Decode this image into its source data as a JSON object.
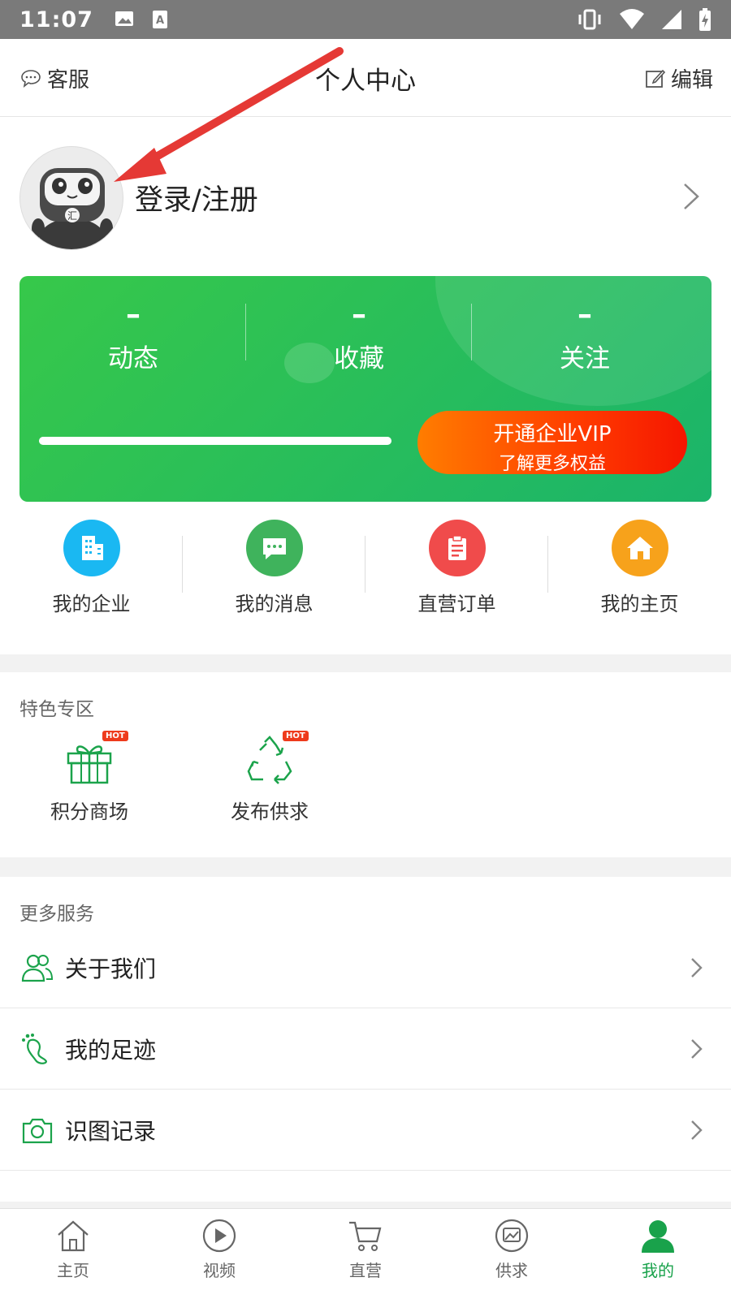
{
  "status_bar": {
    "time": "11:07",
    "icons_left": [
      "image-icon",
      "font-icon"
    ],
    "icons_right": [
      "vibrate-icon",
      "wifi-icon",
      "signal-icon",
      "battery-charging-icon"
    ]
  },
  "header": {
    "left_label": "客服",
    "title": "个人中心",
    "right_label": "编辑"
  },
  "profile": {
    "login_label": "登录/注册",
    "card": {
      "stats": [
        {
          "value": "–",
          "label": "动态"
        },
        {
          "value": "–",
          "label": "收藏"
        },
        {
          "value": "–",
          "label": "关注"
        }
      ],
      "progress": 1.0,
      "vip_line1": "开通企业VIP",
      "vip_line2": "了解更多权益"
    },
    "quick": [
      {
        "label": "我的企业",
        "icon": "building-icon",
        "color": "#1ab8f2"
      },
      {
        "label": "我的消息",
        "icon": "message-icon",
        "color": "#3fb35c"
      },
      {
        "label": "直营订单",
        "icon": "order-icon",
        "color": "#f04b4b"
      },
      {
        "label": "我的主页",
        "icon": "home-icon",
        "color": "#f7a21b"
      }
    ]
  },
  "special": {
    "title": "特色专区",
    "hot_label": "HOT",
    "items": [
      {
        "label": "积分商场",
        "icon": "gift-icon"
      },
      {
        "label": "发布供求",
        "icon": "recycle-icon"
      }
    ]
  },
  "more": {
    "title": "更多服务",
    "items": [
      {
        "label": "关于我们",
        "icon": "users-icon"
      },
      {
        "label": "我的足迹",
        "icon": "footprint-icon"
      },
      {
        "label": "识图记录",
        "icon": "camera-icon"
      }
    ]
  },
  "bottom_nav": [
    {
      "label": "主页",
      "icon": "home-outline-icon"
    },
    {
      "label": "视频",
      "icon": "play-icon"
    },
    {
      "label": "直营",
      "icon": "cart-icon"
    },
    {
      "label": "供求",
      "icon": "supply-icon"
    },
    {
      "label": "我的",
      "icon": "user-icon",
      "active": true
    }
  ],
  "colors": {
    "accent_green": "#19a24b",
    "card_green": "#2bbf5a",
    "vip_orange": "#ff5a00",
    "annotation_red": "#e53935"
  }
}
